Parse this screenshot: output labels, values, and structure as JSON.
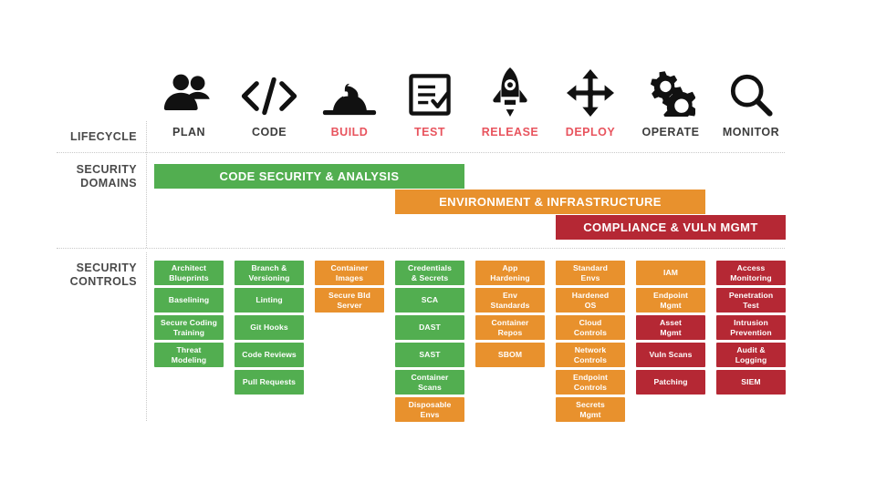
{
  "palette": {
    "green": "#52AE50",
    "orange": "#E8912D",
    "red": "#B52834",
    "label_gray": "#4a4a4a",
    "stage_gray": "#3c3c3c",
    "stage_red": "#e8545e",
    "dotted_gray": "#c9c9c9",
    "white": "#ffffff"
  },
  "rows": {
    "lifecycle_label": "LIFECYCLE",
    "security_domains_label": "SECURITY\nDOMAINS",
    "security_domains_label_line1": "SECURITY",
    "security_domains_label_line2": "DOMAINS",
    "security_controls_label_line1": "SECURITY",
    "security_controls_label_line2": "CONTROLS"
  },
  "lifecycle": {
    "stages": [
      {
        "name": "PLAN",
        "icon": "people-icon",
        "highlighted": false
      },
      {
        "name": "CODE",
        "icon": "code-brackets-icon",
        "highlighted": false
      },
      {
        "name": "BUILD",
        "icon": "hardhat-icon",
        "highlighted": true
      },
      {
        "name": "TEST",
        "icon": "checklist-icon",
        "highlighted": true
      },
      {
        "name": "RELEASE",
        "icon": "rocket-icon",
        "highlighted": true
      },
      {
        "name": "DEPLOY",
        "icon": "move-arrows-icon",
        "highlighted": true
      },
      {
        "name": "OPERATE",
        "icon": "gears-icon",
        "highlighted": false
      },
      {
        "name": "MONITOR",
        "icon": "magnifier-icon",
        "highlighted": false
      }
    ]
  },
  "security_domains": [
    {
      "label": "CODE SECURITY & ANALYSIS",
      "color": "#52AE50",
      "start_stage": "PLAN",
      "end_stage": "TEST"
    },
    {
      "label": "ENVIRONMENT & INFRASTRUCTURE",
      "color": "#E8912D",
      "start_stage": "TEST",
      "end_stage": "OPERATE"
    },
    {
      "label": "COMPLIANCE & VULN MGMT",
      "color": "#B52834",
      "start_stage": "DEPLOY",
      "end_stage": "MONITOR"
    }
  ],
  "security_controls": [
    {
      "stage": "PLAN",
      "items": [
        {
          "label": "Architect Blueprints",
          "line1": "Architect",
          "line2": "Blueprints",
          "color": "#52AE50"
        },
        {
          "label": "Baselining",
          "line1": "Baselining",
          "line2": "",
          "color": "#52AE50"
        },
        {
          "label": "Secure Coding Training",
          "line1": "Secure Coding",
          "line2": "Training",
          "color": "#52AE50"
        },
        {
          "label": "Threat Modeling",
          "line1": "Threat",
          "line2": "Modeling",
          "color": "#52AE50"
        }
      ]
    },
    {
      "stage": "CODE",
      "items": [
        {
          "label": "Branch & Versioning",
          "line1": "Branch &",
          "line2": "Versioning",
          "color": "#52AE50"
        },
        {
          "label": "Linting",
          "line1": "Linting",
          "line2": "",
          "color": "#52AE50"
        },
        {
          "label": "Git Hooks",
          "line1": "Git Hooks",
          "line2": "",
          "color": "#52AE50"
        },
        {
          "label": "Code Reviews",
          "line1": "Code Reviews",
          "line2": "",
          "color": "#52AE50"
        },
        {
          "label": "Pull Requests",
          "line1": "Pull Requests",
          "line2": "",
          "color": "#52AE50"
        }
      ]
    },
    {
      "stage": "BUILD",
      "items": [
        {
          "label": "Container Images",
          "line1": "Container",
          "line2": "Images",
          "color": "#E8912D"
        },
        {
          "label": "Secure Bld Server",
          "line1": "Secure Bld",
          "line2": "Server",
          "color": "#E8912D"
        }
      ]
    },
    {
      "stage": "TEST",
      "items": [
        {
          "label": "Credentials & Secrets",
          "line1": "Credentials",
          "line2": "& Secrets",
          "color": "#52AE50"
        },
        {
          "label": "SCA",
          "line1": "SCA",
          "line2": "",
          "color": "#52AE50"
        },
        {
          "label": "DAST",
          "line1": "DAST",
          "line2": "",
          "color": "#52AE50"
        },
        {
          "label": "SAST",
          "line1": "SAST",
          "line2": "",
          "color": "#52AE50"
        },
        {
          "label": "Container Scans",
          "line1": "Container",
          "line2": "Scans",
          "color": "#52AE50"
        },
        {
          "label": "Disposable Envs",
          "line1": "Disposable",
          "line2": "Envs",
          "color": "#E8912D"
        }
      ]
    },
    {
      "stage": "RELEASE",
      "items": [
        {
          "label": "App Hardening",
          "line1": "App",
          "line2": "Hardening",
          "color": "#E8912D"
        },
        {
          "label": "Env Standards",
          "line1": "Env",
          "line2": "Standards",
          "color": "#E8912D"
        },
        {
          "label": "Container Repos",
          "line1": "Container",
          "line2": "Repos",
          "color": "#E8912D"
        },
        {
          "label": "SBOM",
          "line1": "SBOM",
          "line2": "",
          "color": "#E8912D"
        }
      ]
    },
    {
      "stage": "DEPLOY",
      "items": [
        {
          "label": "Standard Envs",
          "line1": "Standard",
          "line2": "Envs",
          "color": "#E8912D"
        },
        {
          "label": "Hardened OS",
          "line1": "Hardened",
          "line2": "OS",
          "color": "#E8912D"
        },
        {
          "label": "Cloud Controls",
          "line1": "Cloud",
          "line2": "Controls",
          "color": "#E8912D"
        },
        {
          "label": "Network Controls",
          "line1": "Network",
          "line2": "Controls",
          "color": "#E8912D"
        },
        {
          "label": "Endpoint Controls",
          "line1": "Endpoint",
          "line2": "Controls",
          "color": "#E8912D"
        },
        {
          "label": "Secrets Mgmt",
          "line1": "Secrets",
          "line2": "Mgmt",
          "color": "#E8912D"
        }
      ]
    },
    {
      "stage": "OPERATE",
      "items": [
        {
          "label": "IAM",
          "line1": "IAM",
          "line2": "",
          "color": "#E8912D"
        },
        {
          "label": "Endpoint Mgmt",
          "line1": "Endpoint",
          "line2": "Mgmt",
          "color": "#E8912D"
        },
        {
          "label": "Asset Mgmt",
          "line1": "Asset",
          "line2": "Mgmt",
          "color": "#B52834"
        },
        {
          "label": "Vuln Scans",
          "line1": "Vuln Scans",
          "line2": "",
          "color": "#B52834"
        },
        {
          "label": "Patching",
          "line1": "Patching",
          "line2": "",
          "color": "#B52834"
        }
      ]
    },
    {
      "stage": "MONITOR",
      "items": [
        {
          "label": "Access Monitoring",
          "line1": "Access",
          "line2": "Monitoring",
          "color": "#B52834"
        },
        {
          "label": "Penetration Test",
          "line1": "Penetration",
          "line2": "Test",
          "color": "#B52834"
        },
        {
          "label": "Intrusion Prevention",
          "line1": "Intrusion",
          "line2": "Prevention",
          "color": "#B52834"
        },
        {
          "label": "Audit & Logging",
          "line1": "Audit &",
          "line2": "Logging",
          "color": "#B52834"
        },
        {
          "label": "SIEM",
          "line1": "SIEM",
          "line2": "",
          "color": "#B52834"
        }
      ]
    }
  ]
}
